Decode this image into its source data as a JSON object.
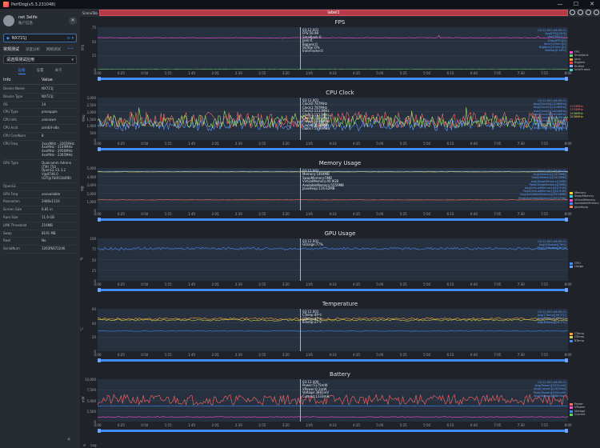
{
  "window": {
    "title": "PerfDog(v5.3.231048)",
    "controls": [
      "—",
      "☐",
      "✕"
    ]
  },
  "user": {
    "name": "net 3elife",
    "sub": "账户信息"
  },
  "device": {
    "name": "NX721J",
    "selected": true
  },
  "mode_tabs": [
    "常规测试",
    "深度分析",
    "网络测试"
  ],
  "app_select": {
    "placeholder": "请选择测试应用"
  },
  "sub_tabs": [
    "设备",
    "设置",
    "关于"
  ],
  "info": {
    "headers": [
      "Info",
      "Value"
    ],
    "rows": [
      [
        "Device Name",
        "NX721J"
      ],
      [
        "Device Type",
        "NX721J"
      ],
      [
        "OS",
        "14"
      ],
      [
        "CPU Type",
        "pineapple"
      ],
      [
        "CPU Info",
        "unknown"
      ],
      [
        "CPU Arch",
        "arm64-v8a"
      ],
      [
        "CPU CoreNum",
        "8"
      ],
      [
        "CPU Freq",
        "3xxxMHz - 3265MHz\n4xxMHz - 3149MHz\n4xxMHz - 2956MHz\n4xxMHz - 2305MHz"
      ],
      [
        "GPU Type",
        "Qualcomm Adreno (TM) 750\nOpenGL ES 3.2 V@0746.0\n(GIT@7b0f31b6f8)"
      ],
      [
        "OpenGL",
        ""
      ],
      [
        "GPU Freq",
        "unavailable"
      ],
      [
        "Resolution",
        "2480x1116"
      ],
      [
        "Screen Size",
        "6.81 in"
      ],
      [
        "Ram Size",
        "11.6 GB"
      ],
      [
        "LMK Threshold",
        "216MB"
      ],
      [
        "Swap",
        "8191 MB"
      ],
      [
        "Root",
        "No"
      ],
      [
        "SerialNum",
        "3263f6672246"
      ]
    ]
  },
  "scene_tab": "SceneTab",
  "label_bar": "label1",
  "x_ticks": [
    "0:00",
    "0:25",
    "0:50",
    "1:15",
    "1:40",
    "2:05",
    "2:30",
    "2:55",
    "3:20",
    "3:45",
    "4:10",
    "4:35",
    "5:00",
    "5:25",
    "5:50",
    "6:15",
    "6:40",
    "7:05",
    "7:30",
    "7:55",
    "8:00"
  ],
  "panels": [
    {
      "id": "fps",
      "title": "FPS",
      "ylabel": "FPS",
      "yticks": [
        "75",
        "50",
        "25",
        "0"
      ],
      "readout": "03:12.001\nFPS:59.99\nSmallJank:0\nJank:0\nBigJank:0\nStutter:0%\nInterFrame:0",
      "avg": "03:12.001-08:00.01\nAvg(FPS)[59.8]\nVar(FPS)[0.2]\nDrop(FPS)[0]\nJank(/10min)[0]\nBigJank(/10min)[0]\nStutter[0.04%]",
      "legend": [
        {
          "name": "FPS",
          "color": "#ff4fd8"
        },
        {
          "name": "SmallJank",
          "color": "#5fd35f"
        },
        {
          "name": "Jank",
          "color": "#ff9f2f"
        },
        {
          "name": "BigJank",
          "color": "#ff3b3b"
        },
        {
          "name": "Stutter",
          "color": "#8fa3ff"
        },
        {
          "name": "InterFrame",
          "color": "#3fd3d3"
        }
      ]
    },
    {
      "id": "cpu",
      "title": "CPU Clock",
      "ylabel": "MHz",
      "yticks": [
        "3,000",
        "2,500",
        "2,000",
        "1,500",
        "1,000",
        "500",
        "0"
      ],
      "readout": "03:12.001\nClock0:787MHz\nClock1:787MHz\nClock2:1133MHz\nClock3:1133MHz\nClock4:1536MHz\nClock5:1536MHz\nClock6:1536MHz\nClock7:1190MHz",
      "avg": "03:12.001-08:00.01\nAvg(Clock0)[1208MHz]\nAvg(Clock1)[1208MHz]\nAvg(Clock2)[1404MHz]\nAvg(Clock3)[1404MHz]\nAvg(Clock4)[1404MHz]\nAvg(Clock5)[1550MHz]\nAvg(Clock6)[1550MHz]\nAvg(Clock7)[1230MHz]",
      "side_values": [
        "1133MHz",
        "1133MHz",
        "1536MHz",
        "1536MHz"
      ]
    },
    {
      "id": "mem",
      "title": "Memory Usage",
      "ylabel": "MB",
      "yticks": [
        "5,000",
        "4,000",
        "3,000",
        "2,000",
        "1,000",
        "0"
      ],
      "readout": "03:12.001\nMemory:1494MB\nSwapMemory:5MB\nVirtualMemory:40.9GB\nAvailableMemory:5559MB\nJavaHeap:116.62MB",
      "avg": "03:12.001-08:00.01\nAvg(Memory)[1479MB]\nPeak(Memory)[1510MB]\nAvg(SwapMemory)[5MB]\nPeak(SwapMemory)[5MB]\nAvg(VirtualMemory)[40.9GB]\nPeak(VirtualMemory)[40.9GB]\nAvg(AvailableMemory)[5524MB]\nPeak(AvailableMemory)[5557MB]",
      "legend": [
        {
          "name": "Memory",
          "color": "#ffd22f"
        },
        {
          "name": "SwapMemory",
          "color": "#3fd3d3"
        },
        {
          "name": "VirtualMemory",
          "color": "#ff4fd8"
        },
        {
          "name": "AvailableMemory",
          "color": "#3f8cff"
        },
        {
          "name": "JavaHeap",
          "color": "#ff7f50"
        }
      ]
    },
    {
      "id": "gpu",
      "title": "GPU Usage",
      "ylabel": "%",
      "yticks": [
        "100",
        "75",
        "50",
        "25",
        "0"
      ],
      "readout": "03:12.001\nGUsage:77%",
      "avg": "03:12.001-08:00.01\nAvg(GUsage)[76%]\nPeak(GUsage)[87%]",
      "legend": [
        {
          "name": "GPU",
          "color": "#3f8cff"
        },
        {
          "name": "Usage",
          "color": "#5fa0ff"
        }
      ]
    },
    {
      "id": "temp",
      "title": "Temperature",
      "ylabel": "°C",
      "yticks": [
        "60",
        "40",
        "20",
        "0"
      ],
      "readout": "03:12.001\nCTemp:49℃\nGTemp:47℃\nBTemp:27℃",
      "avg": "03:12.001-08:00.01\nAvg(CTemp)[46.5℃]\nAvg(GTemp)[45.5℃]\nAvg(BTemp)[28.7℃]",
      "legend": [
        {
          "name": "CTemp",
          "color": "#ff9f2f"
        },
        {
          "name": "GTemp",
          "color": "#cfd34f"
        },
        {
          "name": "BTemp",
          "color": "#3f8cff"
        }
      ]
    },
    {
      "id": "battery",
      "title": "Battery",
      "ylabel": "mW",
      "yticks": [
        "10,000",
        "7,500",
        "5,000",
        "2,500",
        "0"
      ],
      "readout": "03:12.400\nPower:5175mW\nVPower:0.1mW\nVoltage:3881mV\nCurrent:1333mA",
      "avg": "03:12.001-08:00.01\nAvg(Power)[5375mW]\nAvg(Current)[1425mA]\nPeak(Power)[9550mW]\nAvg(Voltage)[3863mV]",
      "legend": [
        {
          "name": "Power",
          "color": "#ff6a6a"
        },
        {
          "name": "VPower",
          "color": "#ff4fd8"
        },
        {
          "name": "Voltage",
          "color": "#3f8cff"
        },
        {
          "name": "Current",
          "color": "#5fd35f"
        }
      ]
    }
  ],
  "footer": {
    "log_label": "Log"
  }
}
